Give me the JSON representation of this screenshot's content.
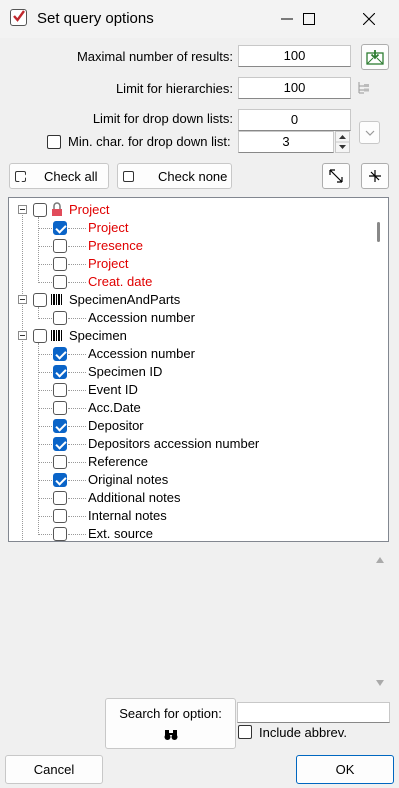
{
  "window": {
    "title": "Set query options"
  },
  "options": {
    "max_results_label": "Maximal number of results:",
    "max_results_value": "100",
    "limit_hierarchies_label": "Limit for hierarchies:",
    "limit_hierarchies_value": "100",
    "limit_dropdown_label": "Limit for drop down lists:",
    "limit_dropdown_value": "0",
    "min_char_label": "Min. char. for drop down list:",
    "min_char_value": "3"
  },
  "actions": {
    "check_all": "Check all",
    "check_none": "Check none"
  },
  "tree": [
    {
      "label": "Project",
      "level": 0,
      "checked": false,
      "red": true,
      "icon": "lock-icon"
    },
    {
      "label": "Project",
      "level": 1,
      "checked": true,
      "red": true
    },
    {
      "label": "Presence",
      "level": 1,
      "checked": false,
      "red": true
    },
    {
      "label": "Project",
      "level": 1,
      "checked": false,
      "red": true
    },
    {
      "label": "Creat. date",
      "level": 1,
      "checked": false,
      "red": true
    },
    {
      "label": "SpecimenAndParts",
      "level": 0,
      "checked": false,
      "red": false,
      "icon": "barcode-icon"
    },
    {
      "label": "Accession number",
      "level": 1,
      "checked": false,
      "red": false
    },
    {
      "label": "Specimen",
      "level": 0,
      "checked": false,
      "red": false,
      "icon": "barcode-icon"
    },
    {
      "label": "Accession number",
      "level": 1,
      "checked": true,
      "red": false
    },
    {
      "label": "Specimen ID",
      "level": 1,
      "checked": true,
      "red": false
    },
    {
      "label": "Event ID",
      "level": 1,
      "checked": false,
      "red": false
    },
    {
      "label": "Acc.Date",
      "level": 1,
      "checked": false,
      "red": false
    },
    {
      "label": "Depositor",
      "level": 1,
      "checked": true,
      "red": false
    },
    {
      "label": "Depositors accession number",
      "level": 1,
      "checked": true,
      "red": false
    },
    {
      "label": "Reference",
      "level": 1,
      "checked": false,
      "red": false
    },
    {
      "label": "Original notes",
      "level": 1,
      "checked": true,
      "red": false
    },
    {
      "label": "Additional notes",
      "level": 1,
      "checked": false,
      "red": false
    },
    {
      "label": "Internal notes",
      "level": 1,
      "checked": false,
      "red": false
    },
    {
      "label": "Ext. source",
      "level": 1,
      "checked": false,
      "red": false
    }
  ],
  "search": {
    "label": "Search for option:",
    "value": "",
    "include_abbrev": "Include abbrev."
  },
  "footer": {
    "cancel": "Cancel",
    "ok": "OK"
  },
  "colors": {
    "accent": "#0067c0",
    "red_text": "#e00000"
  }
}
